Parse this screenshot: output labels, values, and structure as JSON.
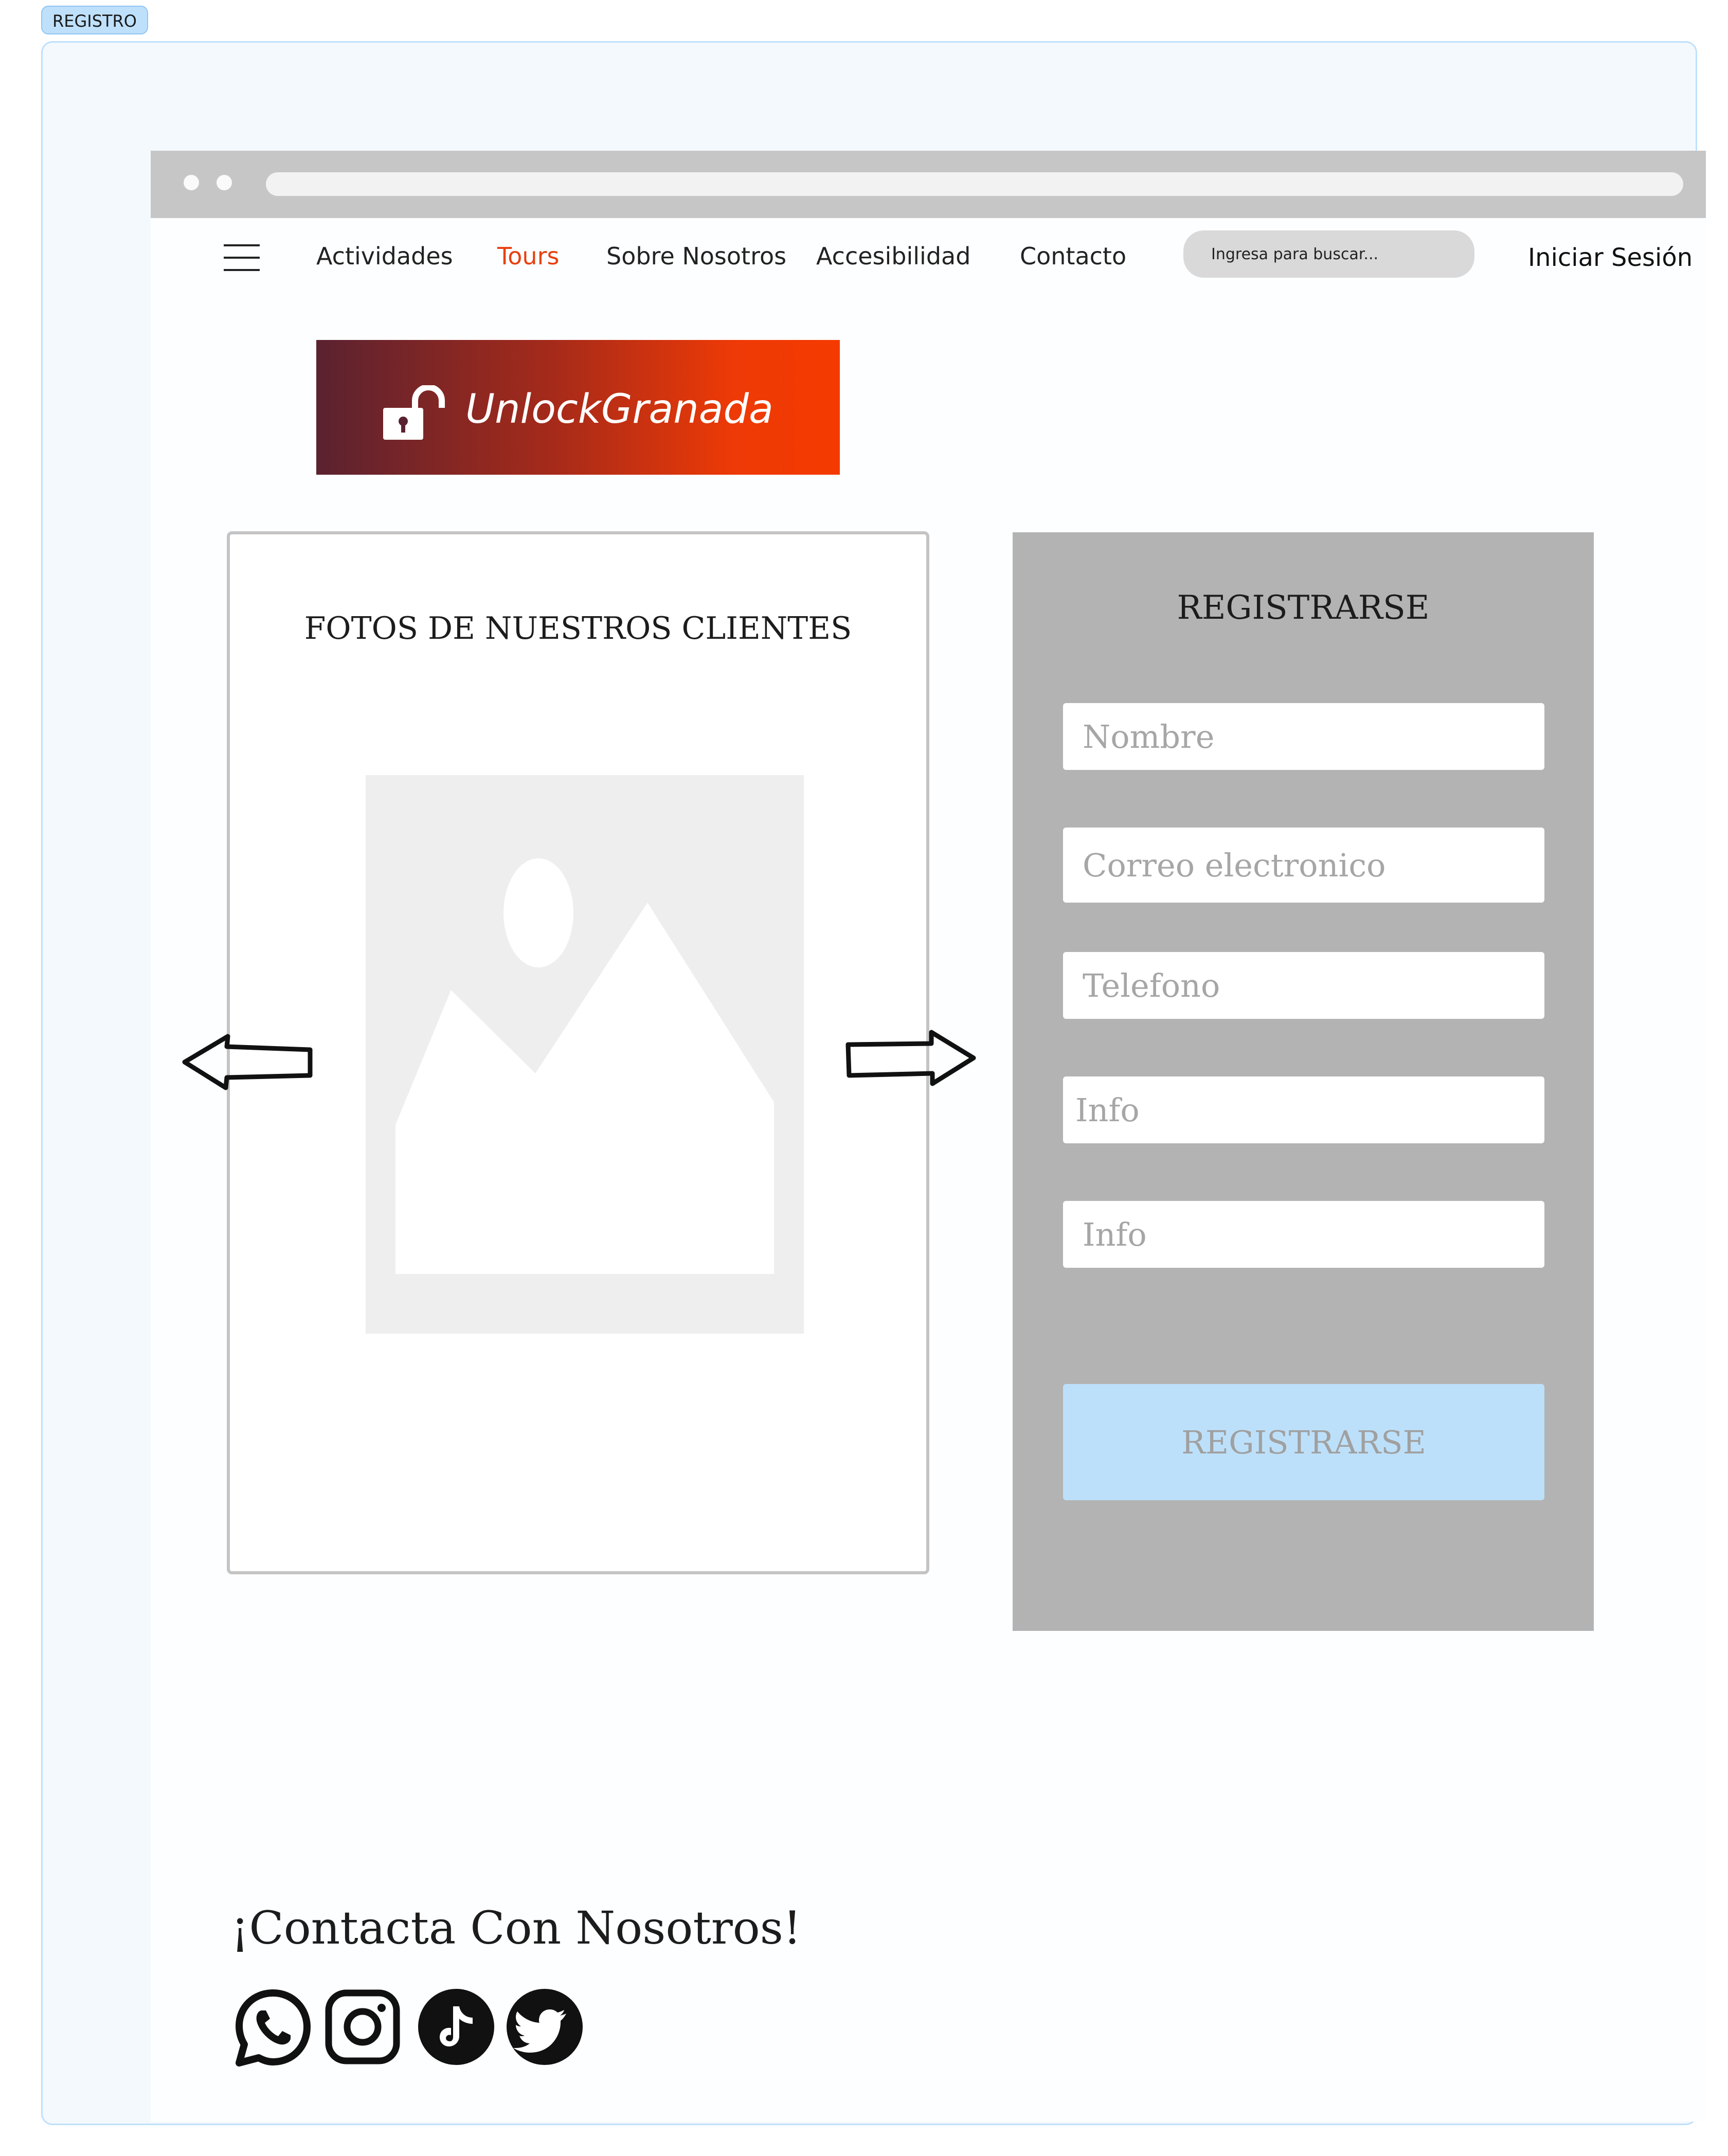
{
  "frame": {
    "tag": "REGISTRO"
  },
  "nav": {
    "items": [
      "Actividades",
      "Tours",
      "Sobre Nosotros",
      "Accesibilidad",
      "Contacto"
    ],
    "active": "Tours",
    "search_placeholder": "Ingresa para buscar...",
    "login_label": "Iniciar Sesión"
  },
  "brand": {
    "name": "UnlockGranada"
  },
  "photos": {
    "title": "FOTOS DE NUESTROS CLIENTES"
  },
  "register": {
    "title": "REGISTRARSE",
    "fields": [
      {
        "placeholder": "Nombre"
      },
      {
        "placeholder": "Correo electronico"
      },
      {
        "placeholder": "Telefono"
      },
      {
        "placeholder": "Info"
      },
      {
        "placeholder": "Info"
      }
    ],
    "submit_label": "REGISTRARSE"
  },
  "footer": {
    "contact_title": "¡Contacta Con Nosotros!",
    "social": [
      "whatsapp-icon",
      "instagram-icon",
      "tiktok-icon",
      "twitter-icon"
    ]
  },
  "colors": {
    "accent": "#e8400f",
    "brand_gradient": [
      "#5a2230",
      "#f43a00"
    ],
    "panel": "#b3b3b3",
    "submit_button": "#bde0fa"
  }
}
